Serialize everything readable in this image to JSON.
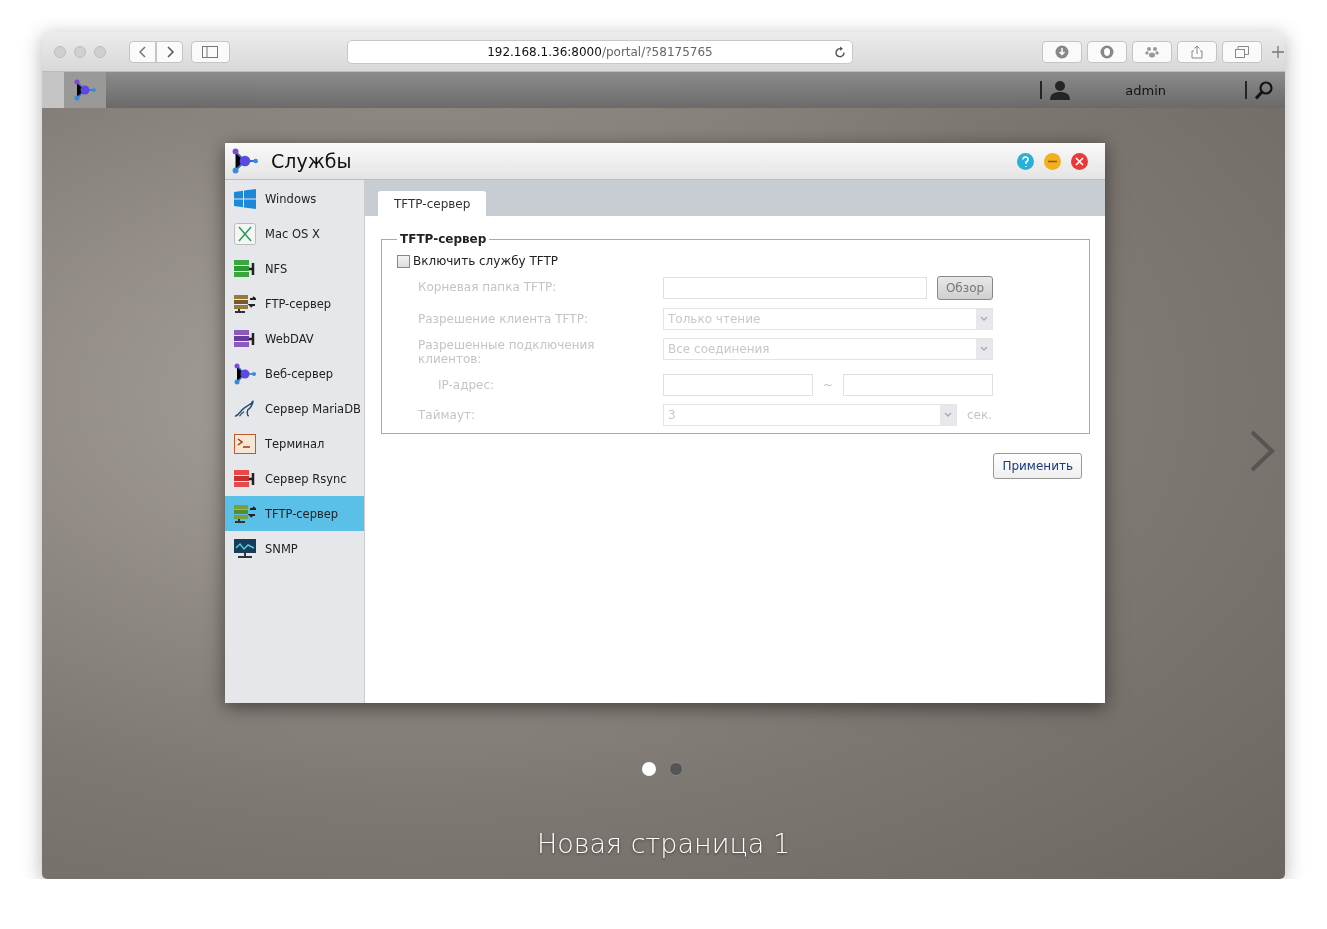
{
  "browser": {
    "url_host": "192.168.1.36:8000",
    "url_path": "/portal/?58175765"
  },
  "topbar": {
    "user": "admin"
  },
  "window": {
    "title": "Службы",
    "sidebar": [
      {
        "label": "Windows",
        "kind": "windows",
        "selected": false
      },
      {
        "label": "Mac OS X",
        "kind": "macos",
        "selected": false
      },
      {
        "label": "NFS",
        "kind": "nfs",
        "selected": false
      },
      {
        "label": "FTP-сервер",
        "kind": "ftp",
        "selected": false
      },
      {
        "label": "WebDAV",
        "kind": "webdav",
        "selected": false
      },
      {
        "label": "Веб-сервер",
        "kind": "web",
        "selected": false
      },
      {
        "label": "Сервер MariaDB",
        "kind": "mariadb",
        "selected": false
      },
      {
        "label": "Терминал",
        "kind": "terminal",
        "selected": false
      },
      {
        "label": "Сервер Rsync",
        "kind": "rsync",
        "selected": false
      },
      {
        "label": "TFTP-сервер",
        "kind": "tftp",
        "selected": true
      },
      {
        "label": "SNMP",
        "kind": "snmp",
        "selected": false
      }
    ],
    "tabs": [
      {
        "label": "TFTP-сервер",
        "selected": true
      }
    ],
    "fieldset": {
      "legend": "TFTP-сервер",
      "enable": {
        "label": "Включить службу TFTP",
        "checked": false
      },
      "rows": [
        {
          "kind": "browse",
          "label": "Корневая папка TFTP:",
          "button": "Обзор",
          "disabled": true
        },
        {
          "kind": "select",
          "label": "Разрешение клиента TFTP:",
          "value": "Только чтение",
          "disabled": true
        },
        {
          "kind": "select",
          "label": "Разрешенные подключения клиентов:",
          "value": "Все соединения",
          "disabled": true
        },
        {
          "kind": "range",
          "label": "IP-адрес:",
          "separator": "~",
          "disabled": true
        },
        {
          "kind": "select-unit",
          "label": "Таймаут:",
          "value": "3",
          "unit": "сек.",
          "disabled": true
        }
      ]
    },
    "apply": "Применить"
  },
  "pager": {
    "dots": [
      {
        "selected": true
      },
      {
        "selected": false
      }
    ],
    "caption": "Новая страница 1"
  }
}
